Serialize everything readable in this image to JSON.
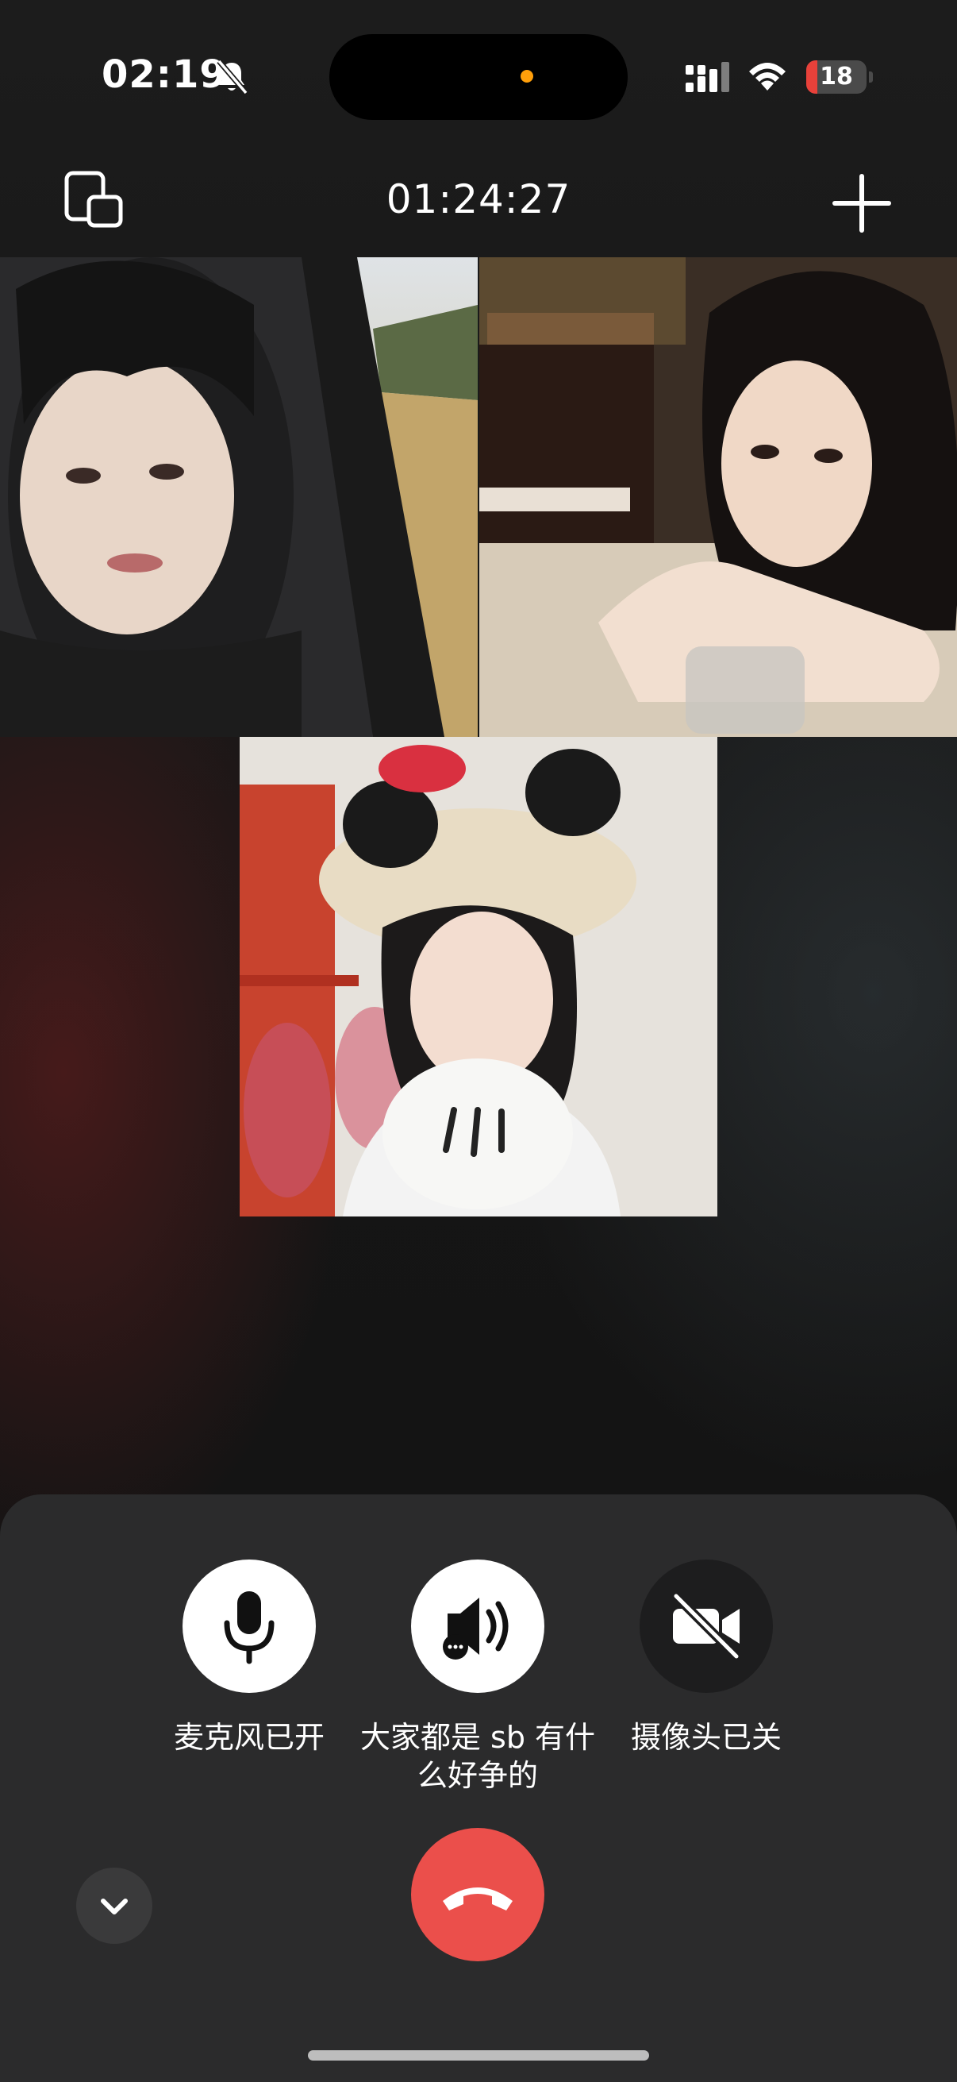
{
  "status_bar": {
    "time": "02:19",
    "battery_level": "18",
    "icons": [
      "bell-slash-icon",
      "cellular-signal-icon",
      "wifi-icon",
      "battery-icon"
    ]
  },
  "call": {
    "duration": "01:24:27",
    "participants": [
      {
        "tile": "participant-video-1"
      },
      {
        "tile": "participant-video-2"
      },
      {
        "tile": "participant-video-3"
      }
    ]
  },
  "controls": {
    "mic_label": "麦克风已开",
    "speaker_label": "大家都是 sb 有什么好争的",
    "camera_label": "摄像头已关"
  },
  "colors": {
    "end_call": "#eb4f4b",
    "battery_low": "#e8413a",
    "sheet": "#2b2b2c"
  }
}
